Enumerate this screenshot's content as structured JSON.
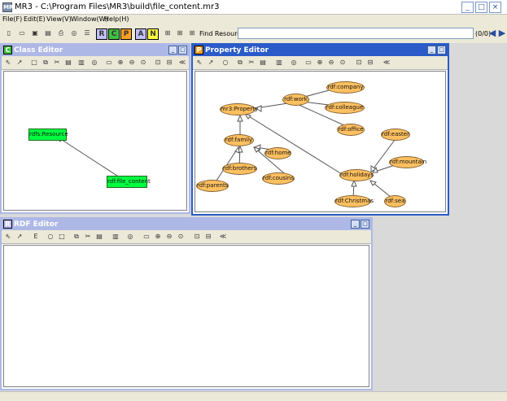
{
  "window": {
    "title": "MR3 - C:\\Program Files\\MR3\\build\\file_content.mr3",
    "icon": "MR",
    "minimize": "_",
    "maximize": "□",
    "close": "×"
  },
  "menu": [
    "File(F)",
    "Edit(E)",
    "View(V)",
    "Window(W)",
    "Help(H)"
  ],
  "toolbar": {
    "letters": [
      "R",
      "C",
      "P",
      "A",
      "N"
    ],
    "letter_colors": [
      "#c0c0ff",
      "#40c040",
      "#ffa020",
      "#c0c0ff",
      "#ffff40"
    ],
    "find_label": "Find Resource:",
    "find_value": "",
    "find_count": "(0/0)",
    "prev_icon": "◀",
    "next_icon": "▶"
  },
  "class_editor": {
    "title": "Class Editor",
    "icon_letter": "C",
    "icon_color": "#40c040",
    "nodes": [
      {
        "label": "rdfs:Resource"
      },
      {
        "label": "rdf:file_content"
      }
    ]
  },
  "property_editor": {
    "title": "Property Editor",
    "icon_letter": "P",
    "icon_color": "#ffa020",
    "nodes": [
      {
        "label": "rdf:company"
      },
      {
        "label": "rdf:work"
      },
      {
        "label": "rdf:colleague"
      },
      {
        "label": "mr3:Property"
      },
      {
        "label": "rdf:office"
      },
      {
        "label": "rdf:easter"
      },
      {
        "label": "rdf:family"
      },
      {
        "label": "rdf:home"
      },
      {
        "label": "rdf:mountain"
      },
      {
        "label": "rdf:brothers"
      },
      {
        "label": "rdf:holidays"
      },
      {
        "label": "rdf:cousins"
      },
      {
        "label": "rdf:parents"
      },
      {
        "label": "rdf:Christmas"
      },
      {
        "label": "rdf:sea"
      }
    ]
  },
  "rdf_editor": {
    "title": "RDF Editor",
    "icon_letter": "R",
    "icon_color": "#c0c0ff"
  },
  "frame_buttons": {
    "minimize": "_",
    "maximize": "□"
  }
}
